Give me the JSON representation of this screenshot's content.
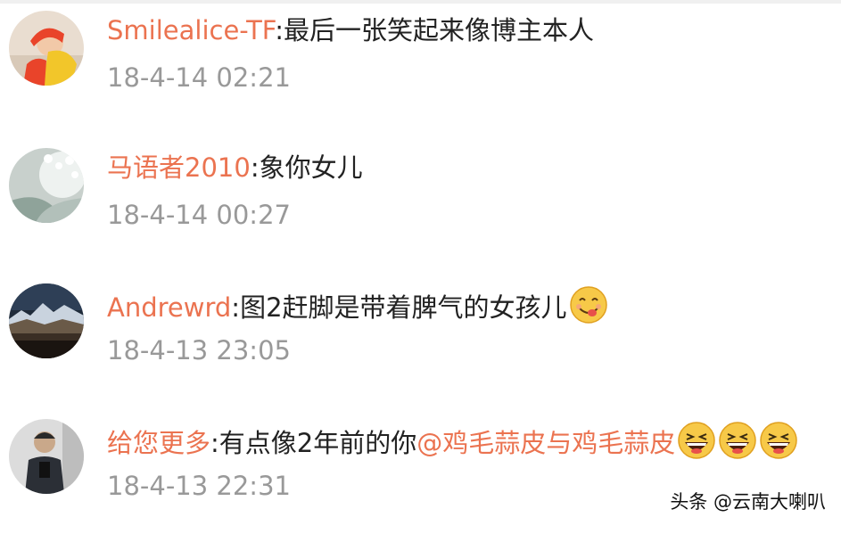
{
  "comments": [
    {
      "user": "Smilealice-TF",
      "separator": ":",
      "text": "最后一张笑起来像博主本人",
      "mention": "",
      "time": "18-4-14 02:21"
    },
    {
      "user": "马语者2010",
      "separator": ":",
      "text": "象你女儿",
      "mention": "",
      "time": "18-4-14 00:27"
    },
    {
      "user": "Andrewrd",
      "separator": ":",
      "text": "图2赶脚是带着脾气的女孩儿",
      "mention": "",
      "time": "18-4-13 23:05",
      "emoji": "yummy-face-emoji"
    },
    {
      "user": "给您更多",
      "separator": ":",
      "text": "有点像2年前的你",
      "mention": "@鸡毛蒜皮与鸡毛蒜皮",
      "time": "18-4-13 22:31",
      "emoji": "laughing-face-emoji"
    }
  ],
  "watermark": "头条 @云南大喇叭",
  "colors": {
    "username": "#eb7350",
    "text": "#222222",
    "timestamp": "#999999"
  }
}
